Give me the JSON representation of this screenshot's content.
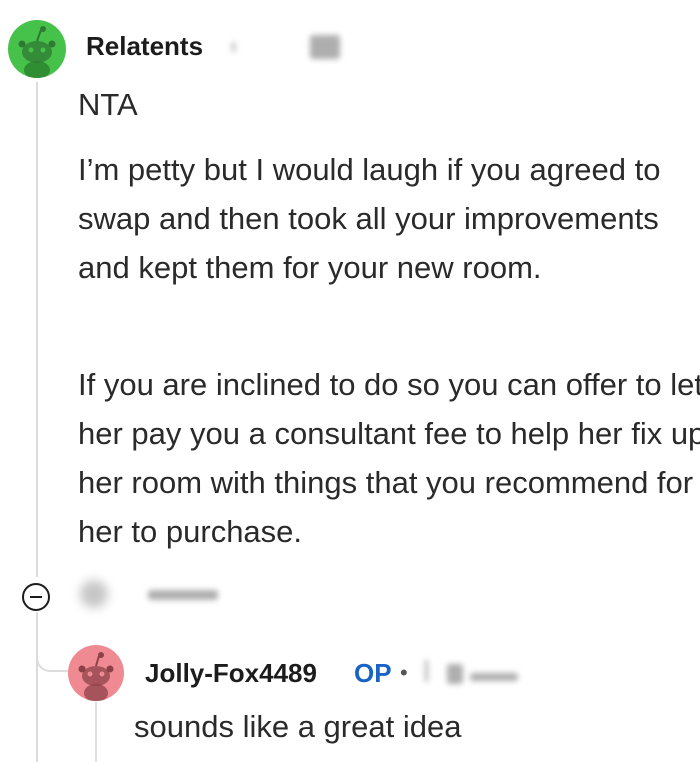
{
  "comments": [
    {
      "username": "Relatents",
      "avatar_color": "#46c24a",
      "paragraphs": [
        "NTA",
        "I’m petty but I would laugh if you agreed to swap and then took all your improvements and kept them for your new room.",
        "If you are inclined to do so you can offer to let her pay you a consultant fee to help her fix up her room with things that you recommend for her to purchase."
      ]
    },
    {
      "username": "Jolly-Fox4489",
      "op_badge": "OP",
      "separator": "•",
      "avatar_color": "#f08a92",
      "text": "sounds like a great idea"
    }
  ],
  "icons": {
    "collapse": "minus-circle-icon",
    "snoo_avatar": "snoo-avatar-icon"
  }
}
